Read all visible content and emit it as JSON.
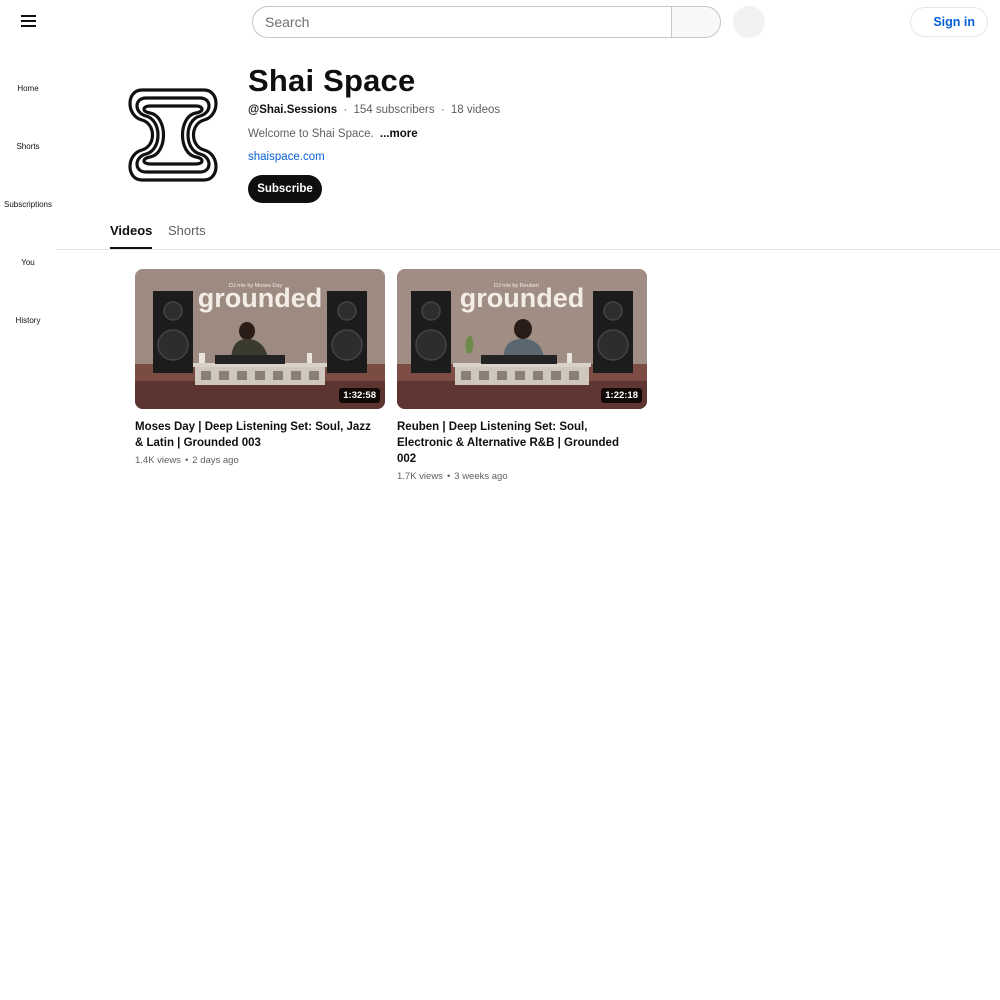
{
  "header": {
    "search_placeholder": "Search",
    "sign_in_label": "Sign in"
  },
  "sidebar": {
    "items": [
      {
        "label": "Home"
      },
      {
        "label": "Shorts"
      },
      {
        "label": "Subscriptions"
      },
      {
        "label": "You"
      },
      {
        "label": "History"
      }
    ]
  },
  "channel": {
    "name": "Shai Space",
    "handle": "@Shai.Sessions",
    "subscribers": "154 subscribers",
    "videos_count": "18 videos",
    "meta_separator": "·",
    "description": "Welcome to Shai Space.",
    "more_label": "...more",
    "link": "shaispace.com",
    "subscribe_label": "Subscribe"
  },
  "tabs": [
    {
      "label": "Videos",
      "active": true
    },
    {
      "label": "Shorts",
      "active": false
    }
  ],
  "videos": [
    {
      "title": "Moses Day | Deep Listening Set: Soul, Jazz & Latin | Grounded 003",
      "duration": "1:32:58",
      "views": "1.4K views",
      "age": "2 days ago",
      "thumb_small_text": "DJ mix by Moses Day",
      "thumb_big_text": "grounded"
    },
    {
      "title": "Reuben | Deep Listening Set: Soul, Electronic & Alternative R&B | Grounded 002",
      "duration": "1:22:18",
      "views": "1.7K views",
      "age": "3 weeks ago",
      "thumb_small_text": "DJ mix by Reuben",
      "thumb_big_text": "grounded"
    }
  ],
  "colors": {
    "link": "#065fd4",
    "text_primary": "#0f0f0f",
    "text_secondary": "#606060",
    "thumb_wall": "#9b8a80"
  }
}
